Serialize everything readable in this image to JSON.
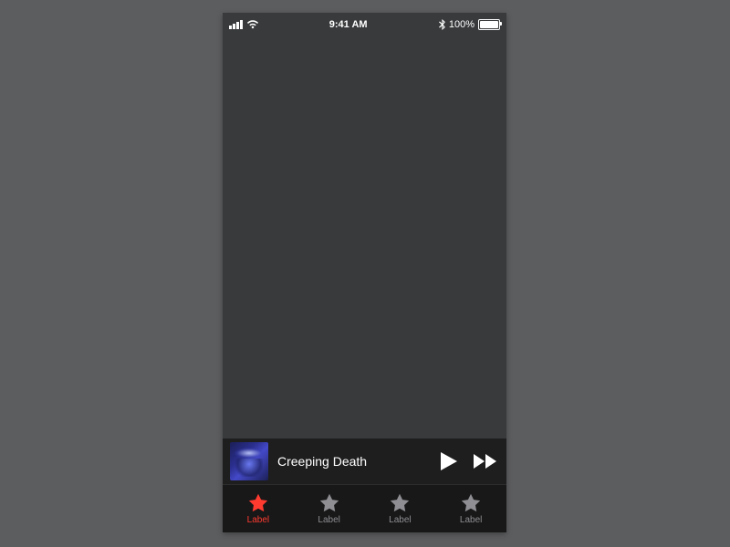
{
  "status": {
    "time": "9:41 AM",
    "battery_pct": "100%"
  },
  "now_playing": {
    "track_title": "Creeping Death"
  },
  "tabs": [
    {
      "label": "Label",
      "active": true
    },
    {
      "label": "Label",
      "active": false
    },
    {
      "label": "Label",
      "active": false
    },
    {
      "label": "Label",
      "active": false
    }
  ]
}
